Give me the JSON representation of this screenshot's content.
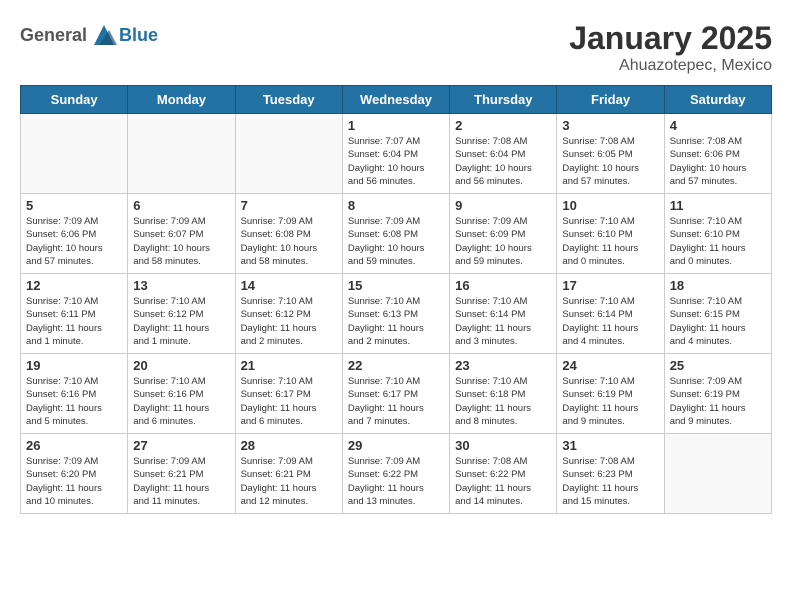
{
  "header": {
    "logo_general": "General",
    "logo_blue": "Blue",
    "month": "January 2025",
    "location": "Ahuazotepec, Mexico"
  },
  "weekdays": [
    "Sunday",
    "Monday",
    "Tuesday",
    "Wednesday",
    "Thursday",
    "Friday",
    "Saturday"
  ],
  "weeks": [
    [
      {
        "day": "",
        "info": ""
      },
      {
        "day": "",
        "info": ""
      },
      {
        "day": "",
        "info": ""
      },
      {
        "day": "1",
        "info": "Sunrise: 7:07 AM\nSunset: 6:04 PM\nDaylight: 10 hours\nand 56 minutes."
      },
      {
        "day": "2",
        "info": "Sunrise: 7:08 AM\nSunset: 6:04 PM\nDaylight: 10 hours\nand 56 minutes."
      },
      {
        "day": "3",
        "info": "Sunrise: 7:08 AM\nSunset: 6:05 PM\nDaylight: 10 hours\nand 57 minutes."
      },
      {
        "day": "4",
        "info": "Sunrise: 7:08 AM\nSunset: 6:06 PM\nDaylight: 10 hours\nand 57 minutes."
      }
    ],
    [
      {
        "day": "5",
        "info": "Sunrise: 7:09 AM\nSunset: 6:06 PM\nDaylight: 10 hours\nand 57 minutes."
      },
      {
        "day": "6",
        "info": "Sunrise: 7:09 AM\nSunset: 6:07 PM\nDaylight: 10 hours\nand 58 minutes."
      },
      {
        "day": "7",
        "info": "Sunrise: 7:09 AM\nSunset: 6:08 PM\nDaylight: 10 hours\nand 58 minutes."
      },
      {
        "day": "8",
        "info": "Sunrise: 7:09 AM\nSunset: 6:08 PM\nDaylight: 10 hours\nand 59 minutes."
      },
      {
        "day": "9",
        "info": "Sunrise: 7:09 AM\nSunset: 6:09 PM\nDaylight: 10 hours\nand 59 minutes."
      },
      {
        "day": "10",
        "info": "Sunrise: 7:10 AM\nSunset: 6:10 PM\nDaylight: 11 hours\nand 0 minutes."
      },
      {
        "day": "11",
        "info": "Sunrise: 7:10 AM\nSunset: 6:10 PM\nDaylight: 11 hours\nand 0 minutes."
      }
    ],
    [
      {
        "day": "12",
        "info": "Sunrise: 7:10 AM\nSunset: 6:11 PM\nDaylight: 11 hours\nand 1 minute."
      },
      {
        "day": "13",
        "info": "Sunrise: 7:10 AM\nSunset: 6:12 PM\nDaylight: 11 hours\nand 1 minute."
      },
      {
        "day": "14",
        "info": "Sunrise: 7:10 AM\nSunset: 6:12 PM\nDaylight: 11 hours\nand 2 minutes."
      },
      {
        "day": "15",
        "info": "Sunrise: 7:10 AM\nSunset: 6:13 PM\nDaylight: 11 hours\nand 2 minutes."
      },
      {
        "day": "16",
        "info": "Sunrise: 7:10 AM\nSunset: 6:14 PM\nDaylight: 11 hours\nand 3 minutes."
      },
      {
        "day": "17",
        "info": "Sunrise: 7:10 AM\nSunset: 6:14 PM\nDaylight: 11 hours\nand 4 minutes."
      },
      {
        "day": "18",
        "info": "Sunrise: 7:10 AM\nSunset: 6:15 PM\nDaylight: 11 hours\nand 4 minutes."
      }
    ],
    [
      {
        "day": "19",
        "info": "Sunrise: 7:10 AM\nSunset: 6:16 PM\nDaylight: 11 hours\nand 5 minutes."
      },
      {
        "day": "20",
        "info": "Sunrise: 7:10 AM\nSunset: 6:16 PM\nDaylight: 11 hours\nand 6 minutes."
      },
      {
        "day": "21",
        "info": "Sunrise: 7:10 AM\nSunset: 6:17 PM\nDaylight: 11 hours\nand 6 minutes."
      },
      {
        "day": "22",
        "info": "Sunrise: 7:10 AM\nSunset: 6:17 PM\nDaylight: 11 hours\nand 7 minutes."
      },
      {
        "day": "23",
        "info": "Sunrise: 7:10 AM\nSunset: 6:18 PM\nDaylight: 11 hours\nand 8 minutes."
      },
      {
        "day": "24",
        "info": "Sunrise: 7:10 AM\nSunset: 6:19 PM\nDaylight: 11 hours\nand 9 minutes."
      },
      {
        "day": "25",
        "info": "Sunrise: 7:09 AM\nSunset: 6:19 PM\nDaylight: 11 hours\nand 9 minutes."
      }
    ],
    [
      {
        "day": "26",
        "info": "Sunrise: 7:09 AM\nSunset: 6:20 PM\nDaylight: 11 hours\nand 10 minutes."
      },
      {
        "day": "27",
        "info": "Sunrise: 7:09 AM\nSunset: 6:21 PM\nDaylight: 11 hours\nand 11 minutes."
      },
      {
        "day": "28",
        "info": "Sunrise: 7:09 AM\nSunset: 6:21 PM\nDaylight: 11 hours\nand 12 minutes."
      },
      {
        "day": "29",
        "info": "Sunrise: 7:09 AM\nSunset: 6:22 PM\nDaylight: 11 hours\nand 13 minutes."
      },
      {
        "day": "30",
        "info": "Sunrise: 7:08 AM\nSunset: 6:22 PM\nDaylight: 11 hours\nand 14 minutes."
      },
      {
        "day": "31",
        "info": "Sunrise: 7:08 AM\nSunset: 6:23 PM\nDaylight: 11 hours\nand 15 minutes."
      },
      {
        "day": "",
        "info": ""
      }
    ]
  ]
}
